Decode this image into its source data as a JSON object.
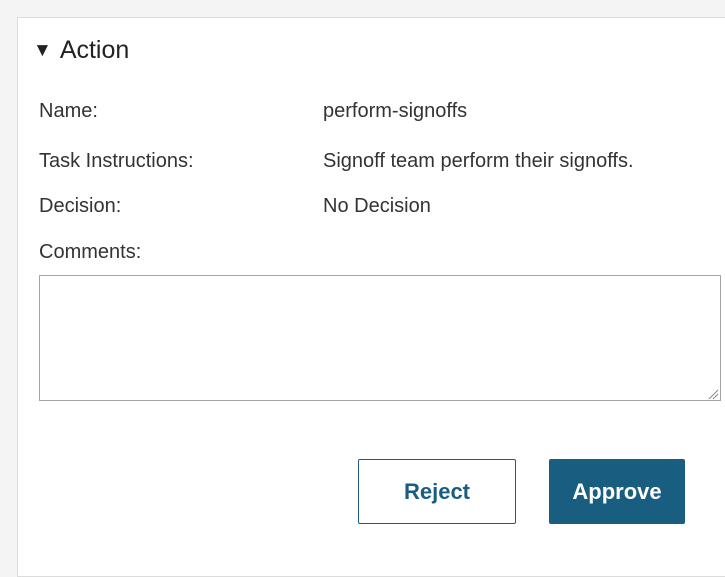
{
  "section": {
    "caret": "▼",
    "title": "Action"
  },
  "fields": {
    "name": {
      "label": "Name:",
      "value": "perform-signoffs"
    },
    "task_instructions": {
      "label": "Task Instructions:",
      "value": "Signoff team perform their signoffs."
    },
    "decision": {
      "label": "Decision:",
      "value": "No Decision"
    },
    "comments": {
      "label": "Comments:",
      "value": "",
      "placeholder": ""
    }
  },
  "buttons": {
    "reject_label": "Reject",
    "approve_label": "Approve"
  },
  "colors": {
    "accent": "#195e80",
    "border": "#a5a5a5",
    "page_background": "#f4f4f4",
    "panel_background": "#ffffff"
  }
}
